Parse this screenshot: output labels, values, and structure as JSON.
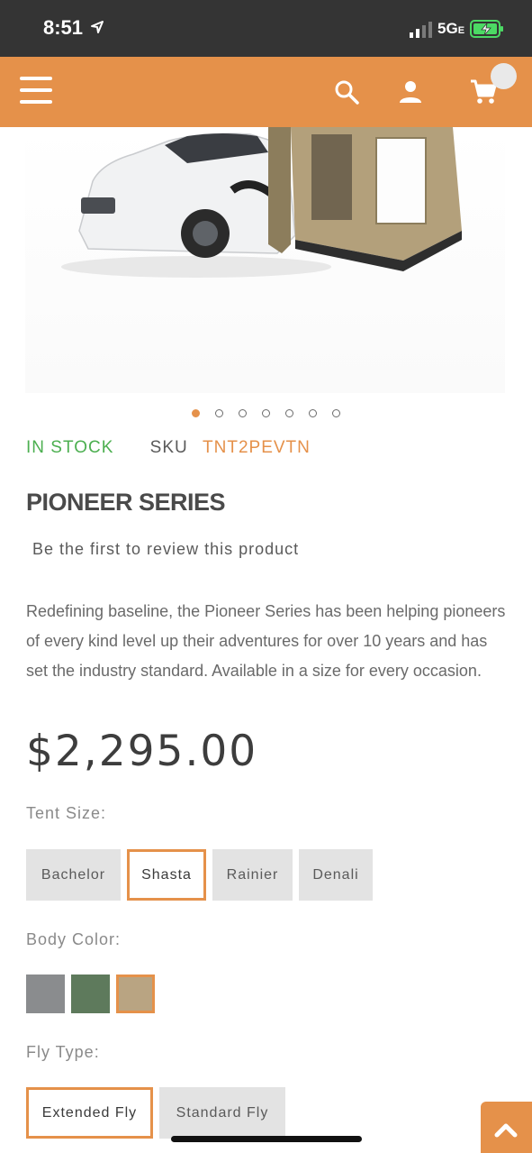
{
  "status_bar": {
    "time": "8:51",
    "network": "5G",
    "network_suffix": "E"
  },
  "nav": {
    "menu_icon": "hamburger-icon",
    "search_icon": "search-icon",
    "account_icon": "user-icon",
    "cart_icon": "cart-icon"
  },
  "gallery": {
    "slide_count": 7,
    "active_index": 0
  },
  "product": {
    "stock_status": "IN STOCK",
    "sku_label": "SKU",
    "sku_value": "TNT2PEVTN",
    "title": "PIONEER SERIES",
    "review_link": "Be the first to review this product",
    "description": "Redefining baseline, the Pioneer Series has been helping pioneers of every kind level up their adventures for over 10 years and has set the industry standard. Available in a size for every occasion.",
    "price": "$2,295.00"
  },
  "options": {
    "tent_size": {
      "label": "Tent Size:",
      "choices": [
        "Bachelor",
        "Shasta",
        "Rainier",
        "Denali"
      ],
      "selected": "Shasta"
    },
    "body_color": {
      "label": "Body Color:",
      "swatches": [
        "#8a8c8e",
        "#5e7a5c",
        "#b9a482"
      ],
      "selected_index": 2
    },
    "fly_type": {
      "label": "Fly Type:",
      "choices": [
        "Extended Fly",
        "Standard Fly"
      ],
      "selected": "Extended Fly"
    }
  },
  "colors": {
    "accent": "#e5914a",
    "status_bar": "#343434",
    "in_stock": "#4caf50"
  }
}
